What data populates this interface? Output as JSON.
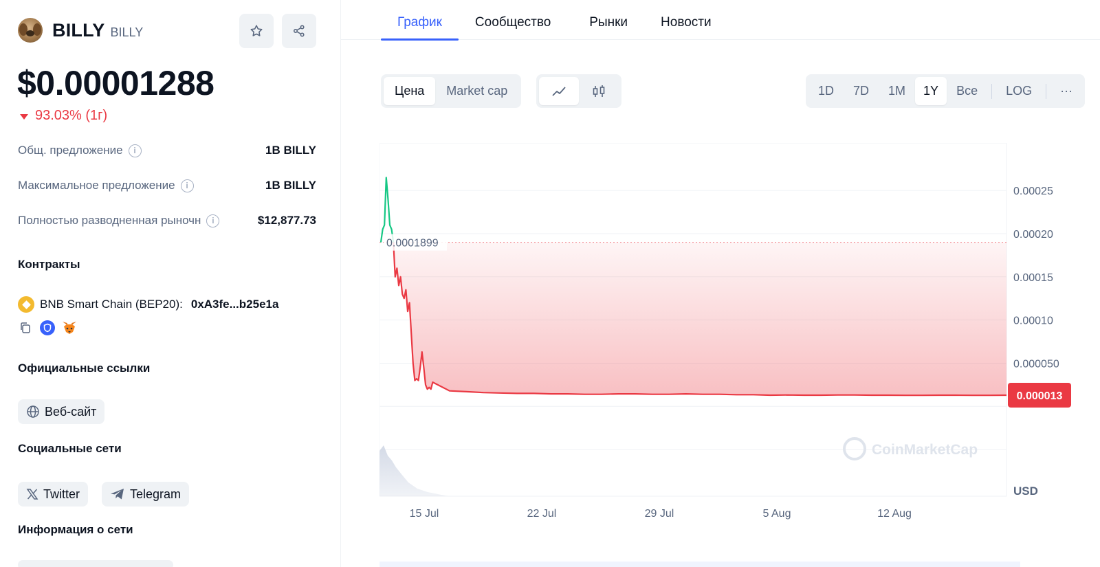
{
  "coin": {
    "name": "BILLY",
    "symbol": "BILLY",
    "price": "$0.00001288",
    "change": "93.03% (1г)"
  },
  "stats": [
    {
      "label": "Общ. предложение",
      "value": "1B BILLY"
    },
    {
      "label": "Максимальное предложение",
      "value": "1B BILLY"
    },
    {
      "label": "Полностью разводненная рыночн",
      "value": "$12,877.73"
    }
  ],
  "contracts": {
    "title": "Контракты",
    "chain": "BNB Smart Chain (BEP20):",
    "address": "0xA3fe...b25e1a"
  },
  "links": {
    "title": "Официальные ссылки",
    "website": "Веб-сайт"
  },
  "social": {
    "title": "Социальные сети",
    "twitter": "Twitter",
    "telegram": "Telegram"
  },
  "network": {
    "title": "Информация о сети"
  },
  "tabs": [
    "График",
    "Сообщество",
    "Рынки",
    "Новости"
  ],
  "chart_controls": {
    "price_label": "Цена",
    "marketcap_label": "Market cap",
    "ranges": [
      "1D",
      "7D",
      "1M",
      "1Y",
      "Все"
    ],
    "selected_range": "1Y",
    "log_label": "LOG",
    "more_label": "···"
  },
  "colors": {
    "up": "#16c784",
    "down": "#ea3943",
    "accent": "#3861fb"
  },
  "chart_data": {
    "type": "line",
    "currency_label": "USD",
    "x_ticks": [
      "15 Jul",
      "22 Jul",
      "29 Jul",
      "5 Aug",
      "12 Aug"
    ],
    "y_ticks": [
      "0.00025",
      "0.00020",
      "0.00015",
      "0.00010",
      "0.000050"
    ],
    "ylim": [
      -0.000104,
      0.000305
    ],
    "reference_price": 0.0001899,
    "reference_label": "0.0001899",
    "current_price": 1.3e-05,
    "current_label": "0.000013",
    "watermark": "CoinMarketCap",
    "series": [
      {
        "values": [
          0.00019,
          0.000205,
          0.00021,
          0.000265,
          0.00024,
          0.00021,
          0.000205,
          0.00019,
          0.00015,
          0.00016,
          0.00014,
          0.00015,
          0.00013,
          0.000125,
          0.000135,
          0.00011,
          0.00012,
          8.5e-05,
          5e-05,
          3e-05,
          3.2e-05,
          3e-05,
          4.5e-05,
          6.3e-05,
          4.5e-05,
          2.5e-05,
          2e-05,
          2.2e-05,
          2e-05,
          2.8e-05,
          1.8e-05,
          1.7e-05,
          1.6e-05,
          1.55e-05,
          1.5e-05,
          1.5e-05,
          1.45e-05,
          1.45e-05,
          1.4e-05,
          1.4e-05,
          1.45e-05,
          1.45e-05,
          1.4e-05,
          1.4e-05,
          1.45e-05,
          1.4e-05,
          1.4e-05,
          1.35e-05,
          1.35e-05,
          1.3e-05,
          1.32e-05,
          1.3e-05,
          1.3e-05,
          1.32e-05,
          1.32e-05,
          1.3e-05,
          1.3e-05,
          1.28e-05,
          1.28e-05,
          1.3e-05,
          1.3e-05,
          1.28e-05,
          1.28e-05,
          1.3e-05
        ]
      }
    ]
  }
}
